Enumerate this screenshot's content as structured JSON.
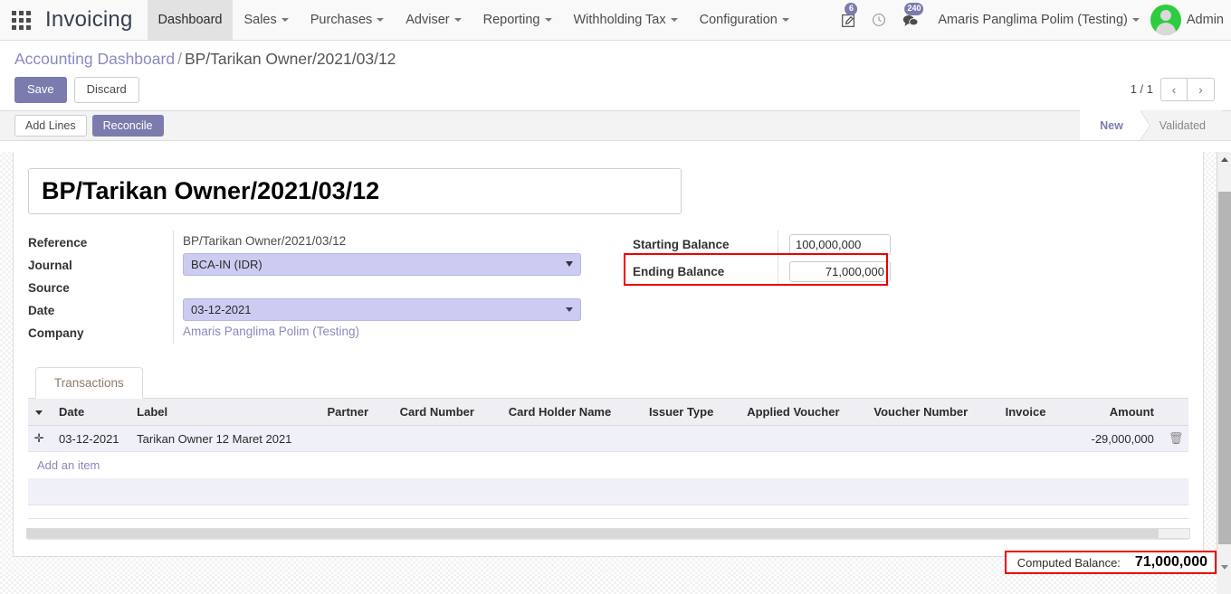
{
  "navbar": {
    "apps_icon": "apps-grid-icon",
    "brand": "Invoicing",
    "menu": [
      {
        "label": "Dashboard",
        "has_caret": false,
        "active": true
      },
      {
        "label": "Sales",
        "has_caret": true,
        "active": false
      },
      {
        "label": "Purchases",
        "has_caret": true,
        "active": false
      },
      {
        "label": "Adviser",
        "has_caret": true,
        "active": false
      },
      {
        "label": "Reporting",
        "has_caret": true,
        "active": false
      },
      {
        "label": "Withholding Tax",
        "has_caret": true,
        "active": false
      },
      {
        "label": "Configuration",
        "has_caret": true,
        "active": false
      }
    ],
    "activities_badge": "6",
    "messages_badge": "240",
    "company_switcher": "Amaris Panglima Polim (Testing)",
    "user_name": "Admin"
  },
  "control_panel": {
    "breadcrumb_root": "Accounting Dashboard",
    "breadcrumb_sep": "/",
    "breadcrumb_current": "BP/Tarikan Owner/2021/03/12",
    "save_label": "Save",
    "discard_label": "Discard",
    "pager_text": "1 / 1",
    "pager_prev": "‹",
    "pager_next": "›"
  },
  "statusbar": {
    "add_lines_label": "Add Lines",
    "reconcile_label": "Reconcile",
    "stages": [
      {
        "label": "New",
        "active": true
      },
      {
        "label": "Validated",
        "active": false
      }
    ]
  },
  "form": {
    "title": "BP/Tarikan Owner/2021/03/12",
    "fields": {
      "reference_label": "Reference",
      "reference_value": "BP/Tarikan Owner/2021/03/12",
      "journal_label": "Journal",
      "journal_value": "BCA-IN (IDR)",
      "source_label": "Source",
      "source_value": "",
      "date_label": "Date",
      "date_value": "03-12-2021",
      "company_label": "Company",
      "company_value": "Amaris Panglima Polim (Testing)"
    },
    "balances": {
      "starting_label": "Starting Balance",
      "starting_value": "100,000,000",
      "ending_label": "Ending Balance",
      "ending_value": "71,000,000"
    }
  },
  "notebook": {
    "tabs": [
      {
        "label": "Transactions",
        "active": true
      }
    ]
  },
  "table": {
    "columns": [
      "Date",
      "Label",
      "Partner",
      "Card Number",
      "Card Holder Name",
      "Issuer Type",
      "Applied Voucher",
      "Voucher Number",
      "Invoice",
      "Amount"
    ],
    "rows": [
      {
        "date": "03-12-2021",
        "label": "Tarikan Owner 12 Maret 2021",
        "partner": "",
        "card_number": "",
        "card_holder_name": "",
        "issuer_type": "",
        "applied_voucher": "",
        "voucher_number": "",
        "invoice": "",
        "amount": "-29,000,000"
      }
    ],
    "add_item_label": "Add an item"
  },
  "footer": {
    "computed_label": "Computed Balance:",
    "computed_value": "71,000,000"
  },
  "colors": {
    "accent_purple": "#7c7bad",
    "highlight_red": "#ee0000",
    "field_lavender": "#ccccf2",
    "row_lavender": "#f0f0f8",
    "avatar_green": "#2ecc40"
  }
}
